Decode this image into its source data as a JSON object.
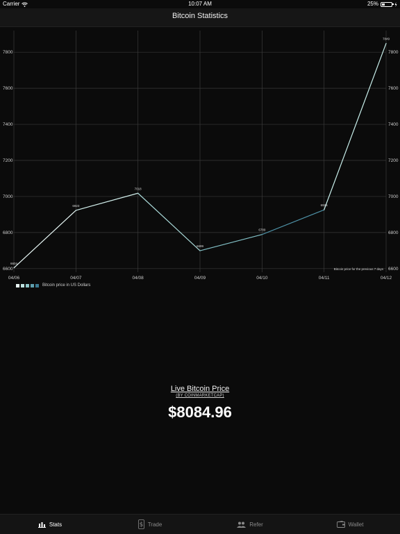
{
  "status_bar": {
    "carrier": "Carrier",
    "time": "10:07 AM",
    "battery": "25%"
  },
  "nav": {
    "title": "Bitcoin Statistics"
  },
  "chart_data": {
    "type": "line",
    "categories": [
      "04/06",
      "04/07",
      "04/08",
      "04/09",
      "04/10",
      "04/11",
      "04/12"
    ],
    "series": [
      {
        "name": "Bitcoin price in US Dollars",
        "values": [
          6604,
          6923,
          7018,
          6699,
          6789,
          6926,
          7849
        ]
      }
    ],
    "data_labels": [
      "6604",
      "6923",
      "7018",
      "6699",
      "6789",
      "6926",
      "7849"
    ],
    "y_ticks": [
      6600,
      6800,
      7000,
      7200,
      7400,
      7600,
      7800
    ],
    "ylim": [
      6580,
      7920
    ],
    "grid": true,
    "annotation": "Bitcoin price for the previous 7 days",
    "legend_colors": [
      "#e8f6f5",
      "#bfe3e0",
      "#8fc7c9",
      "#5f9fae",
      "#3a7890"
    ]
  },
  "live": {
    "title": "Live Bitcoin Price",
    "subtitle": "(BY COINMARKETCAP)",
    "price": "$8084.96"
  },
  "tabs": [
    {
      "label": "Stats",
      "icon": "bar-chart-icon",
      "active": true
    },
    {
      "label": "Trade",
      "icon": "dollar-icon",
      "active": false
    },
    {
      "label": "Refer",
      "icon": "users-icon",
      "active": false
    },
    {
      "label": "Wallet",
      "icon": "wallet-icon",
      "active": false
    }
  ]
}
